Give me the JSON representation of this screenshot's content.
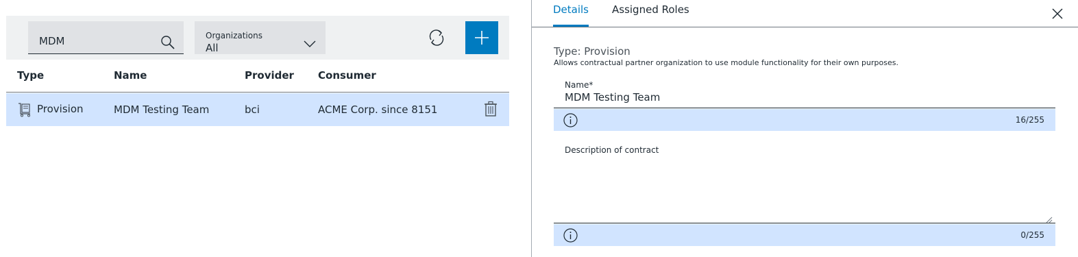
{
  "toolbar": {
    "search_value": "MDM",
    "org_label": "Organizations",
    "org_value": "All"
  },
  "table": {
    "headers": [
      "Type",
      "Name",
      "Provider",
      "Consumer"
    ],
    "rows": [
      {
        "type": "Provision",
        "name": "MDM Testing Team",
        "provider": "bci",
        "consumer": "ACME Corp. since 8151"
      }
    ]
  },
  "details": {
    "tabs": [
      {
        "label": "Details",
        "active": true
      },
      {
        "label": "Assigned Roles",
        "active": false
      }
    ],
    "type_title": "Type: Provision",
    "type_description": "Allows contractual partner organization to use module functionality for their own purposes.",
    "name_field": {
      "label": "Name*",
      "value": "MDM Testing Team",
      "counter": "16/255"
    },
    "description_field": {
      "label": "Description of contract",
      "value": "",
      "counter": "0/255"
    }
  },
  "colors": {
    "accent": "#007bc0",
    "selected_row": "#d1e4ff",
    "toolbar_bg": "#eff1f2",
    "input_bg": "#e0e2e5"
  },
  "icons": [
    "search-icon",
    "chevron-down-icon",
    "refresh-icon",
    "plus-icon",
    "provision-icon",
    "trash-icon",
    "close-icon",
    "info-icon"
  ]
}
